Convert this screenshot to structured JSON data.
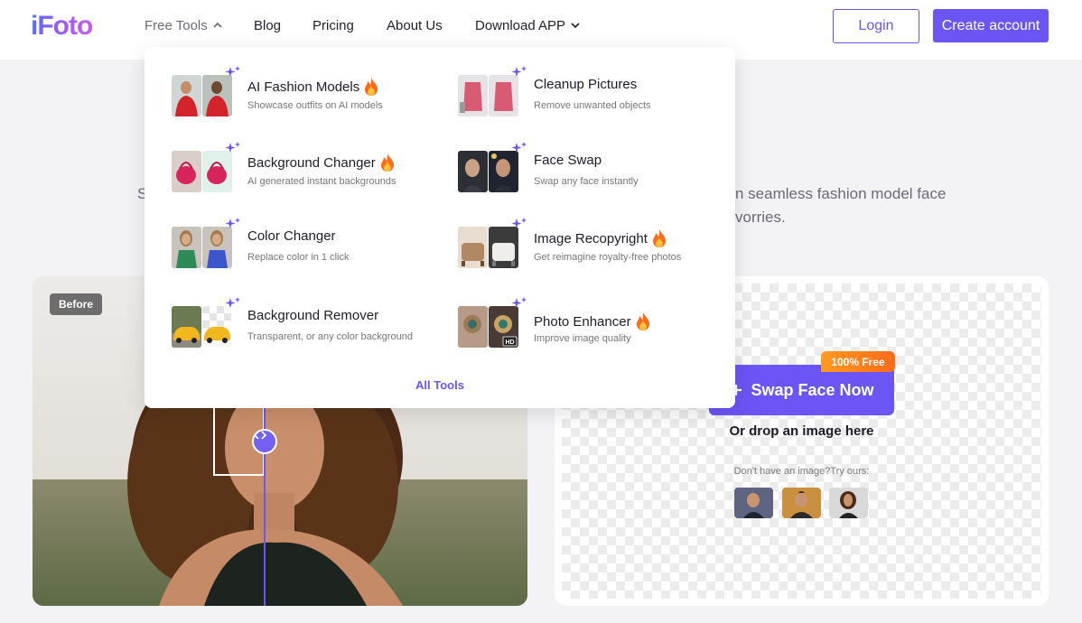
{
  "header": {
    "logo": "iFoto",
    "nav": [
      {
        "label": "Free Tools",
        "has_chevron": true,
        "expanded": true
      },
      {
        "label": "Blog"
      },
      {
        "label": "Pricing"
      },
      {
        "label": "About Us"
      },
      {
        "label": "Download APP",
        "has_chevron": true,
        "expanded": false
      }
    ],
    "login_label": "Login",
    "create_label": "Create account"
  },
  "hero": {
    "frag_left": "S",
    "frag_right_1": "n seamless fashion model face",
    "frag_right_2": "vorries."
  },
  "dropdown": {
    "tools": [
      {
        "title": "AI Fashion Models",
        "desc": "Showcase outfits on AI models",
        "hot": true,
        "thumb": "fashion-models"
      },
      {
        "title": "Cleanup Pictures",
        "desc": "Remove unwanted objects",
        "hot": false,
        "thumb": "cleanup"
      },
      {
        "title": "Background Changer",
        "desc": "AI generated instant backgrounds",
        "hot": true,
        "thumb": "bg-changer"
      },
      {
        "title": "Face Swap",
        "desc": "Swap any face instantly",
        "hot": false,
        "thumb": "face-swap"
      },
      {
        "title": "Color Changer",
        "desc": "Replace color in 1 click",
        "hot": false,
        "thumb": "color-changer"
      },
      {
        "title": "Image Recopyright",
        "desc": "Get reimagine royalty-free photos",
        "hot": true,
        "thumb": "recopyright"
      },
      {
        "title": "Background Remover",
        "desc": "Transparent, or any color background",
        "hot": false,
        "thumb": "bg-remover"
      },
      {
        "title": "Photo Enhancer",
        "desc": "Improve image quality",
        "hot": true,
        "thumb": "enhancer"
      }
    ],
    "all_tools_label": "All Tools"
  },
  "before_after": {
    "before_label": "Before"
  },
  "upload": {
    "free_badge": "100% Free",
    "button_label": "Swap Face Now",
    "drop_text": "Or drop an image here",
    "try_text": "Don't have an image?Try ours:"
  },
  "colors": {
    "accent": "#6b55f5",
    "badge_orange": "#ff8a1f"
  }
}
